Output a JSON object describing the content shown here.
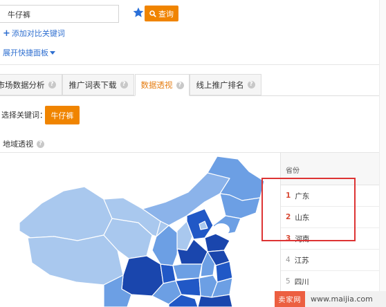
{
  "search": {
    "value": "牛仔裤"
  },
  "search_button": {
    "label": "查询"
  },
  "add_compare": {
    "label": "添加对比关键词"
  },
  "expand_panel": {
    "label": "展开快捷面板"
  },
  "tabs": [
    {
      "label": "市场数据分析",
      "active": false
    },
    {
      "label": "推广词表下载",
      "active": false
    },
    {
      "label": "数据透视",
      "active": true
    },
    {
      "label": "线上推广排名",
      "active": false
    }
  ],
  "keyword_select": {
    "label": "选择关键词：",
    "chip": "牛仔裤"
  },
  "region_view": {
    "title": "地域透视"
  },
  "ranking": {
    "header": "省份",
    "rows": [
      {
        "rank": "1",
        "province": "广东"
      },
      {
        "rank": "2",
        "province": "山东"
      },
      {
        "rank": "3",
        "province": "河南"
      },
      {
        "rank": "4",
        "province": "江苏"
      },
      {
        "rank": "5",
        "province": "四川"
      }
    ]
  },
  "watermark": {
    "logo": "卖家网",
    "url": "www.maijia.com"
  },
  "colors": {
    "accent_orange": "#f08400",
    "link_blue": "#2f6fd0",
    "rank_top_red": "#d84a35",
    "highlight_red": "#dd3333",
    "map_light": "#a9c8ee",
    "map_mid": "#6c9fe4",
    "map_dark": "#2158c6",
    "map_darkest": "#1a46ad"
  },
  "icons": [
    "star-icon",
    "search-icon",
    "plus-icon",
    "caret-down-icon",
    "help-icon"
  ]
}
